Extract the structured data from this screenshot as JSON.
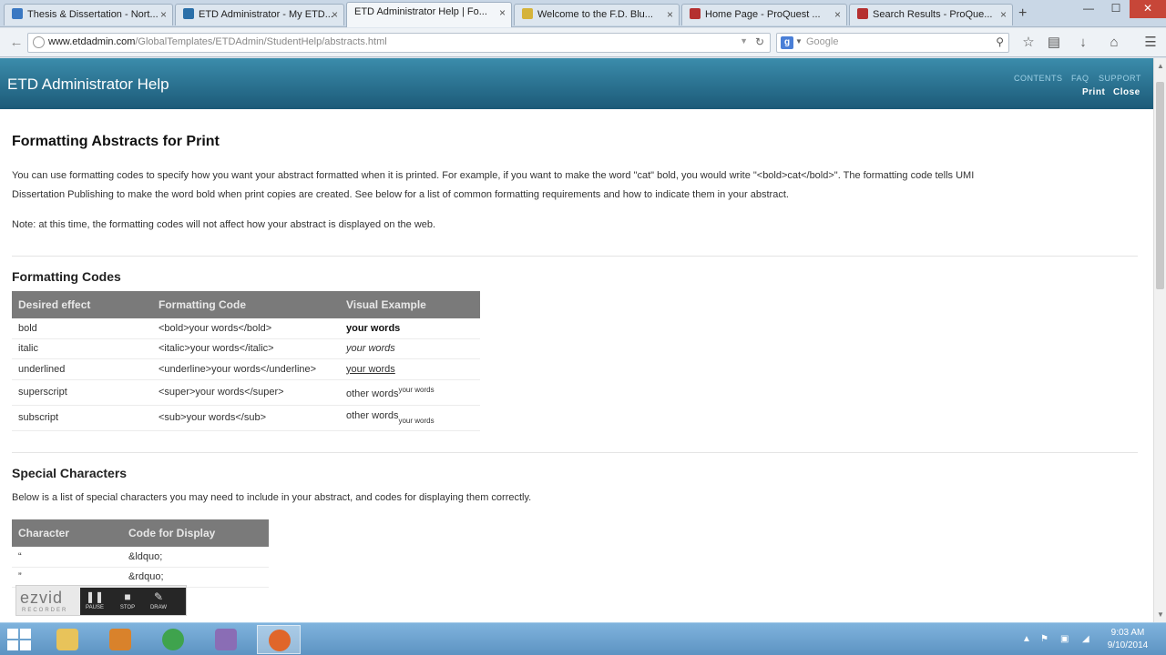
{
  "browser": {
    "tabs": [
      {
        "title": "Thesis & Dissertation - Nort...",
        "fav_color": "#3a78c2"
      },
      {
        "title": "ETD Administrator - My ETD...",
        "fav_color": "#2a6fa8"
      },
      {
        "title": "ETD Administrator Help | Fo...",
        "fav_color": "#2a6fa8",
        "active": true
      },
      {
        "title": "Welcome to the F.D. Blu...",
        "fav_color": "#d5b33a"
      },
      {
        "title": "Home Page - ProQuest ...",
        "fav_color": "#b53030"
      },
      {
        "title": "Search Results - ProQue...",
        "fav_color": "#b53030"
      }
    ],
    "new_tab": "+",
    "window_controls": {
      "minimize": "—",
      "maximize": "☐",
      "close": "✕"
    },
    "url": {
      "host": "www.etdadmin.com",
      "path": "/GlobalTemplates/ETDAdmin/StudentHelp/abstracts.html"
    },
    "search_placeholder": "Google",
    "icons": [
      "star-icon",
      "bookmarks-icon",
      "download-icon",
      "home-icon",
      "menu-icon"
    ]
  },
  "site": {
    "title": "ETD Administrator Help",
    "nav": {
      "contents": "CONTENTS",
      "faq": "FAQ",
      "support": "SUPPORT",
      "print": "Print",
      "close": "Close"
    }
  },
  "page": {
    "title": "Formatting Abstracts for Print",
    "intro_line1": "You can use formatting codes to specify how you want your abstract formatted when it is printed. For example, if you want to make the word \"cat\" bold, you would write \"<bold>cat</bold>\". The formatting code tells UMI",
    "intro_line2": "Dissertation Publishing to make the word bold when print copies are created. See below for a list of common formatting requirements and how to indicate them in your abstract.",
    "note": "Note: at this time, the formatting codes will not affect how your abstract is displayed on the web.",
    "codes_heading": "Formatting Codes",
    "codes_table": {
      "headers": [
        "Desired effect",
        "Formatting Code",
        "Visual Example"
      ],
      "rows": [
        {
          "effect": "bold",
          "code": "<bold>your words</bold>",
          "example": "your words"
        },
        {
          "effect": "italic",
          "code": "<italic>your words</italic>",
          "example": "your words"
        },
        {
          "effect": "underlined",
          "code": "<underline>your words</underline>",
          "example": "your words"
        },
        {
          "effect": "superscript",
          "code": "<super>your words</super>",
          "example": "other words",
          "example_small": "your words"
        },
        {
          "effect": "subscript",
          "code": "<sub>your words</sub>",
          "example": "other words",
          "example_small": "your words"
        }
      ]
    },
    "special_heading": "Special Characters",
    "special_intro": "Below is a list of special characters you may need to include in your abstract, and codes for displaying them correctly.",
    "special_table": {
      "headers": [
        "Character",
        "Code for Display"
      ],
      "rows": [
        {
          "char": "“",
          "code": "&ldquo;"
        },
        {
          "char": "”",
          "code": "&rdquo;"
        }
      ]
    }
  },
  "recorder": {
    "logo": "ezvid",
    "sub": "RECORDER",
    "buttons": [
      {
        "icon": "❚❚",
        "label": "PAUSE"
      },
      {
        "icon": "■",
        "label": "STOP"
      },
      {
        "icon": "✎",
        "label": "DRAW"
      }
    ]
  },
  "taskbar": {
    "apps": [
      {
        "name": "file-explorer-icon",
        "color": "#e8c35a"
      },
      {
        "name": "media-icon",
        "color": "#d9822b"
      },
      {
        "name": "chrome-icon",
        "color": "#3fa34d"
      },
      {
        "name": "tool-icon",
        "color": "#8a6db5"
      },
      {
        "name": "firefox-icon",
        "color": "#e0662a",
        "active": true
      }
    ],
    "time": "9:03 AM",
    "date": "9/10/2014"
  }
}
